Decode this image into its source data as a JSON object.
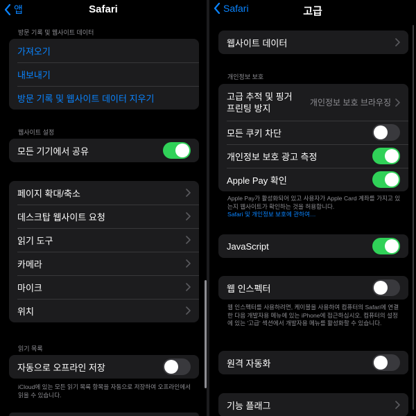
{
  "colors": {
    "accent": "#0a84ff",
    "toggle_on": "#30d158",
    "toggle_off": "#39393d",
    "cell": "#1c1c1e",
    "secondary_text": "#8e8e93"
  },
  "left": {
    "back_label": "앱",
    "title": "Safari",
    "history_header": "방문 기록 및 웹사이트 데이터",
    "history_items": [
      "가져오기",
      "내보내기",
      "방문 기록 및 웹사이트 데이터 지우기"
    ],
    "website_settings_header": "웹사이트 설정",
    "share_across_devices": {
      "label": "모든 기기에서 공유",
      "on": true
    },
    "settings_items": [
      "페이지 확대/축소",
      "데스크탑 웹사이트 요청",
      "읽기 도구",
      "카메라",
      "마이크",
      "위치"
    ],
    "reading_list_header": "읽기 목록",
    "offline_save": {
      "label": "자동으로 오프라인 저장",
      "on": false
    },
    "reading_list_footnote": "iCloud에 있는 모든 읽기 목록 항목을 자동으로 저장하여 오프라인에서 읽을 수 있습니다."
  },
  "right": {
    "back_label": "Safari",
    "title": "고급",
    "website_data": "웹사이트 데이터",
    "privacy_header": "개인정보 보호",
    "tracking": {
      "label": "고급 추적 및 핑거\n프린팅 방지",
      "value": "개인정보 보호 브라우징"
    },
    "block_cookies": {
      "label": "모든 쿠키 차단",
      "on": false
    },
    "privacy_ad": {
      "label": "개인정보 보호 광고 측정",
      "on": true
    },
    "apple_pay": {
      "label": "Apple Pay 확인",
      "on": true
    },
    "apple_pay_footnote": "Apple Pay가 활성화되어 있고 사용자가 Apple Card 계좌를 가지고 있는지 웹사이트가 확인하는 것을 허용합니다.",
    "apple_pay_link": "Safari 및 개인정보 보호에 관하여…",
    "javascript": {
      "label": "JavaScript",
      "on": true
    },
    "web_inspector": {
      "label": "웹 인스펙터",
      "on": false
    },
    "web_inspector_footnote": "웹 인스펙터를 사용하려면, 케이블을 사용하여 컴퓨터의 Safari에 연결한 다음 개발자용 메뉴에 있는 iPhone에 접근하십시오. 컴퓨터의 설정에 있는 '고급' 섹션에서 개발자용 메뉴를 활성화할 수 있습니다.",
    "remote_automation": {
      "label": "원격 자동화",
      "on": false
    },
    "feature_flags": "기능 플래그"
  }
}
